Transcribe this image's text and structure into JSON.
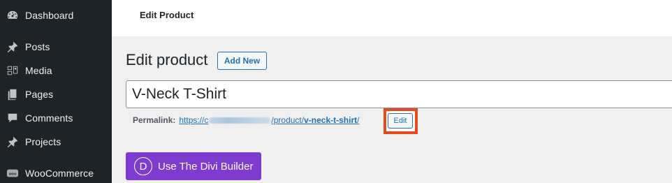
{
  "sidebar": {
    "items": [
      {
        "label": "Dashboard",
        "icon": "dashboard-icon"
      },
      {
        "label": "Posts",
        "icon": "pin-icon"
      },
      {
        "label": "Media",
        "icon": "media-icon"
      },
      {
        "label": "Pages",
        "icon": "pages-icon"
      },
      {
        "label": "Comments",
        "icon": "comment-icon"
      },
      {
        "label": "Projects",
        "icon": "pin-icon"
      },
      {
        "label": "WooCommerce",
        "icon": "woo-icon",
        "badge": "woo"
      }
    ]
  },
  "header": {
    "title": "Edit Product"
  },
  "main": {
    "page_title": "Edit product",
    "add_new_label": "Add New",
    "title_value": "V-Neck T-Shirt",
    "permalink": {
      "label": "Permalink:",
      "url_prefix": "https://c",
      "url_middle": "/product/",
      "slug": "v-neck-t-shirt",
      "url_suffix": "/",
      "edit_label": "Edit"
    },
    "divi_button": {
      "icon_letter": "D",
      "label": "Use The Divi Builder"
    }
  },
  "colors": {
    "sidebar_bg": "#1d2327",
    "link_blue": "#2271b1",
    "divi_purple": "#7e3bd0",
    "highlight_orange": "#e8491d"
  }
}
